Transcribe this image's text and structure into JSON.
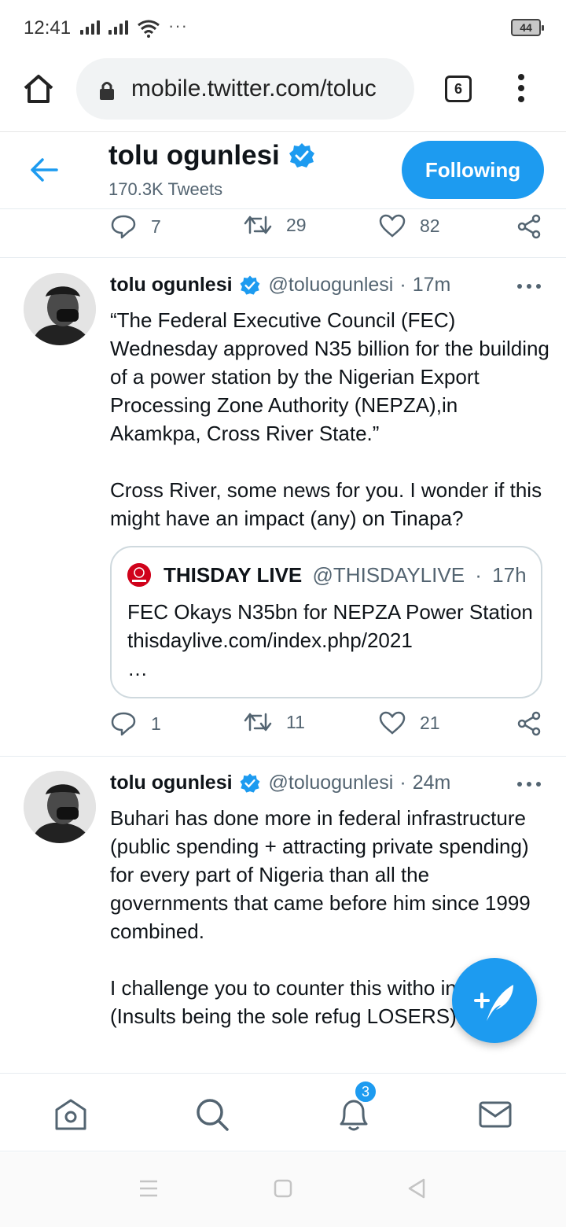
{
  "status_bar": {
    "time": "12:41",
    "more": "···",
    "battery": "44"
  },
  "browser": {
    "url": "mobile.twitter.com/toluc",
    "tab_count": "6"
  },
  "profile": {
    "name": "tolu ogunlesi",
    "tweet_count": "170.3K Tweets",
    "follow_button": "Following"
  },
  "prev_tweet_actions": {
    "replies": "7",
    "retweets": "29",
    "likes": "82"
  },
  "tweets": [
    {
      "name": "tolu ogunlesi",
      "handle": "@toluogunlesi",
      "time": "17m",
      "text": "“The Federal Executive Council (FEC) Wednesday approved N35 billion for the building of a power station by the Nigerian Export Processing Zone Authority (NEPZA),in Akamkpa, Cross River State.”\n\nCross River, some news for you. I wonder if this might have an impact (any) on Tinapa?",
      "quote": {
        "name": "THISDAY LIVE",
        "handle": "@THISDAYLIVE",
        "time": "17h",
        "text": "FEC Okays N35bn for NEPZA Power Station thisdaylive.com/index.php/2021\n…"
      },
      "actions": {
        "replies": "1",
        "retweets": "11",
        "likes": "21"
      }
    },
    {
      "name": "tolu ogunlesi",
      "handle": "@toluogunlesi",
      "time": "24m",
      "text": "Buhari has done more in federal infrastructure (public spending + attracting private spending) for every part of Nigeria than all the governments that came before him since 1999 combined.\n\nI challenge you to counter this witho insults. (Insults being the sole refug LOSERS)."
    }
  ],
  "bottom_nav": {
    "notifications_badge": "3"
  },
  "colors": {
    "accent": "#1d9bf0",
    "text": "#0f1419",
    "muted": "#536471"
  }
}
